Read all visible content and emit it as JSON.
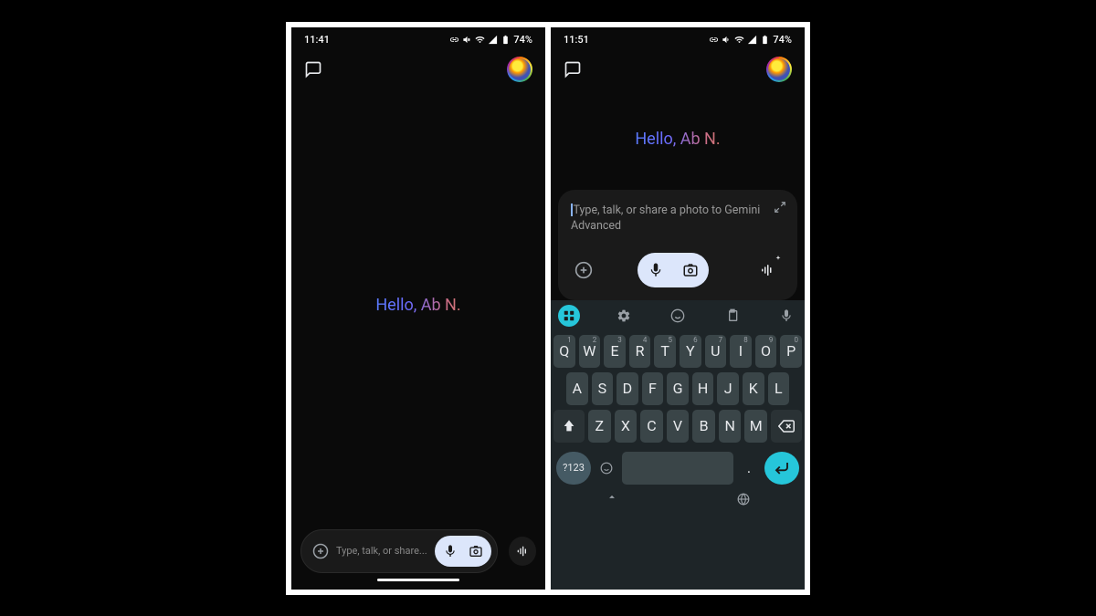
{
  "left": {
    "status": {
      "time": "11:41",
      "battery": "74%"
    },
    "greeting": "Hello, Ab N.",
    "input_placeholder": "Type, talk, or share..."
  },
  "right": {
    "status": {
      "time": "11:51",
      "battery": "74%"
    },
    "greeting": "Hello, Ab N.",
    "input_placeholder": "Type, talk, or share a photo to Gemini Advanced"
  },
  "keyboard": {
    "row1": [
      "Q",
      "W",
      "E",
      "R",
      "T",
      "Y",
      "U",
      "I",
      "O",
      "P"
    ],
    "row1_sup": [
      "1",
      "2",
      "3",
      "4",
      "5",
      "6",
      "7",
      "8",
      "9",
      "0"
    ],
    "row2": [
      "A",
      "S",
      "D",
      "F",
      "G",
      "H",
      "J",
      "K",
      "L"
    ],
    "row3": [
      "Z",
      "X",
      "C",
      "V",
      "B",
      "N",
      "M"
    ],
    "symbols_key": "?123",
    "period_key": "."
  }
}
